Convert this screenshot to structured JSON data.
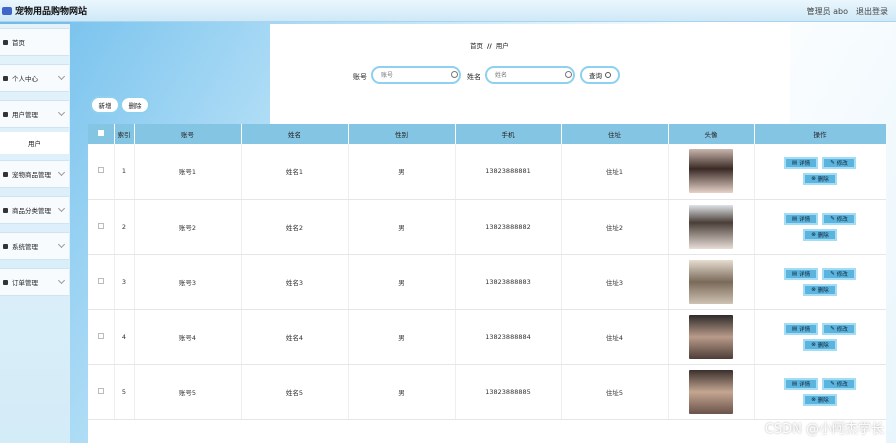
{
  "header": {
    "site_title": "宠物用品购物网站",
    "user_label": "管理员 abo",
    "logout": "退出登录"
  },
  "sidebar": {
    "items": [
      {
        "label": "首页",
        "icon": "home-icon",
        "has_chevron": false
      },
      {
        "label": "个人中心",
        "icon": "person-icon",
        "has_chevron": true
      },
      {
        "label": "用户管理",
        "icon": "chart-icon",
        "has_chevron": true
      },
      {
        "label": "宠物商品管理",
        "icon": "list-icon",
        "has_chevron": true
      },
      {
        "label": "商品分类管理",
        "icon": "grid-icon",
        "has_chevron": true
      },
      {
        "label": "系统管理",
        "icon": "system-icon",
        "has_chevron": true
      },
      {
        "label": "订单管理",
        "icon": "order-icon",
        "has_chevron": true
      }
    ],
    "sub_item": "用户"
  },
  "breadcrumb": {
    "home": "首页",
    "sep": "//",
    "current": "用户"
  },
  "search": {
    "account_label": "账号",
    "account_placeholder": "账号",
    "name_label": "姓名",
    "name_placeholder": "姓名",
    "query_button": "查询"
  },
  "actions": {
    "add": "新增",
    "delete": "删除"
  },
  "table": {
    "headers": [
      "索引",
      "账号",
      "姓名",
      "性别",
      "手机",
      "住址",
      "头像",
      "操作"
    ],
    "rows": [
      {
        "index": "1",
        "account": "账号1",
        "name": "姓名1",
        "gender": "男",
        "phone": "13823888881",
        "address": "住址1"
      },
      {
        "index": "2",
        "account": "账号2",
        "name": "姓名2",
        "gender": "男",
        "phone": "13823888882",
        "address": "住址2"
      },
      {
        "index": "3",
        "account": "账号3",
        "name": "姓名3",
        "gender": "男",
        "phone": "13823888883",
        "address": "住址3"
      },
      {
        "index": "4",
        "account": "账号4",
        "name": "姓名4",
        "gender": "男",
        "phone": "13823888884",
        "address": "住址4"
      },
      {
        "index": "5",
        "account": "账号5",
        "name": "姓名5",
        "gender": "男",
        "phone": "13823888885",
        "address": "住址5"
      }
    ],
    "op_labels": {
      "detail": "详情",
      "edit": "修改",
      "delete": "删除"
    }
  },
  "watermark": "CSDN @小阿杰学长",
  "colors": {
    "accent": "#85c5e4",
    "button_fill": "#5ab4de",
    "button_border": "#a4dcf3"
  }
}
